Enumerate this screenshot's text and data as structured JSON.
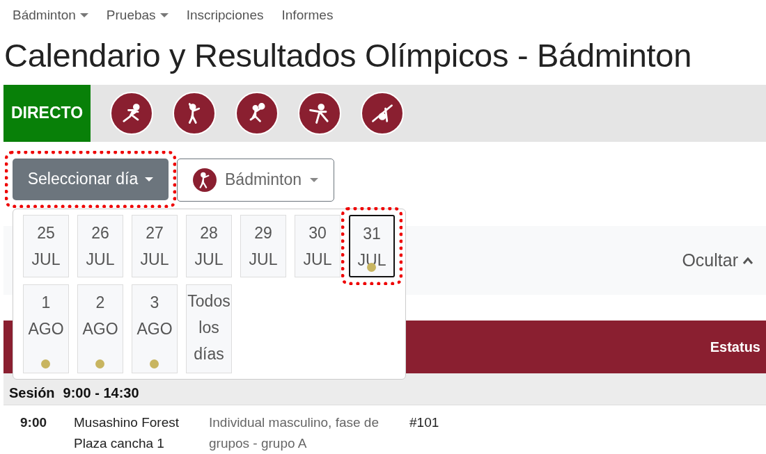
{
  "nav": [
    {
      "label": "Bádminton",
      "dropdown": true
    },
    {
      "label": "Pruebas",
      "dropdown": true
    },
    {
      "label": "Inscripciones",
      "dropdown": false
    },
    {
      "label": "Informes",
      "dropdown": false
    }
  ],
  "title": "Calendario y Resultados Olímpicos - Bádminton",
  "live": {
    "label": "DIRECTO",
    "sports": [
      {
        "kind": "athletics"
      },
      {
        "kind": "badminton"
      },
      {
        "kind": "volleyball"
      },
      {
        "kind": "fencing"
      },
      {
        "kind": "golf"
      }
    ]
  },
  "day_button": {
    "label": "Seleccionar día",
    "highlighted": true
  },
  "sport_button": {
    "label": "Bádminton"
  },
  "days": [
    {
      "number": "25",
      "month": "JUL",
      "has_events": false,
      "selected": false,
      "highlighted": false
    },
    {
      "number": "26",
      "month": "JUL",
      "has_events": false,
      "selected": false,
      "highlighted": false
    },
    {
      "number": "27",
      "month": "JUL",
      "has_events": false,
      "selected": false,
      "highlighted": false
    },
    {
      "number": "28",
      "month": "JUL",
      "has_events": false,
      "selected": false,
      "highlighted": false
    },
    {
      "number": "29",
      "month": "JUL",
      "has_events": false,
      "selected": false,
      "highlighted": false
    },
    {
      "number": "30",
      "month": "JUL",
      "has_events": false,
      "selected": false,
      "highlighted": false
    },
    {
      "number": "31",
      "month": "JUL",
      "has_events": true,
      "selected": true,
      "highlighted": true
    },
    {
      "number": "1",
      "month": "AGO",
      "has_events": true,
      "selected": false,
      "highlighted": false
    },
    {
      "number": "2",
      "month": "AGO",
      "has_events": true,
      "selected": false,
      "highlighted": false
    },
    {
      "number": "3",
      "month": "AGO",
      "has_events": true,
      "selected": false,
      "highlighted": false
    }
  ],
  "all_days": {
    "label": "Todos los días",
    "selected": false
  },
  "filter": {
    "toggle": "Ocultar"
  },
  "table": {
    "columns": [
      "Estatus"
    ],
    "session": {
      "label": "Sesión",
      "time": "9:00 - 14:30"
    },
    "rows": [
      {
        "time": "9:00",
        "venue": "Musashino Forest Plaza cancha 1",
        "event": "Individual masculino, fase de grupos - grupo A",
        "match": "#101"
      }
    ]
  }
}
